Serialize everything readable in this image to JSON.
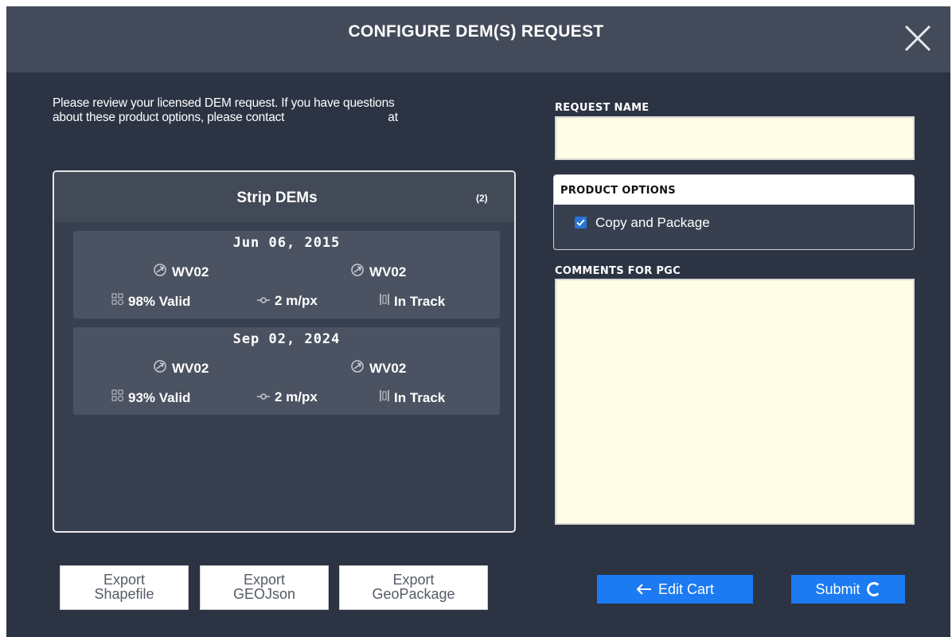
{
  "header": {
    "title": "CONFIGURE DEM(S) REQUEST"
  },
  "intro": {
    "line1": "Please review your licensed DEM request. If you have questions",
    "line2_before": "about these product options, please contact",
    "line2_after": "at"
  },
  "strip_panel": {
    "title": "Strip DEMs",
    "count": "(2)",
    "items": [
      {
        "date": "Jun 06, 2015",
        "sat_left": "WV02",
        "sat_right": "WV02",
        "valid": "98% Valid",
        "resolution": "2 m/px",
        "track": "In Track"
      },
      {
        "date": "Sep 02, 2024",
        "sat_left": "WV02",
        "sat_right": "WV02",
        "valid": "93% Valid",
        "resolution": "2 m/px",
        "track": "In Track"
      }
    ]
  },
  "request_name": {
    "label": "REQUEST NAME",
    "value": ""
  },
  "product_options": {
    "label": "PRODUCT OPTIONS",
    "copy_package_label": "Copy and Package",
    "copy_package_checked": true
  },
  "comments": {
    "label": "COMMENTS FOR PGC",
    "value": ""
  },
  "exports": {
    "shapefile": "Export\nShapefile",
    "geojson": "Export\nGEOJson",
    "geopackage": "Export\nGeoPackage"
  },
  "actions": {
    "edit_cart": "Edit Cart",
    "submit": "Submit"
  },
  "colors": {
    "accent": "#1c7af2",
    "input_bg": "#fffde5",
    "dialog_bg": "#2c3343"
  },
  "icons": {
    "close": "close-icon",
    "satellite": "satellite-icon",
    "valid": "valid-coverage-icon",
    "resolution": "resolution-icon",
    "track": "in-track-icon",
    "checkbox": "checkmark-icon",
    "back": "arrow-left-icon",
    "spinner": "loading-spinner-icon"
  }
}
